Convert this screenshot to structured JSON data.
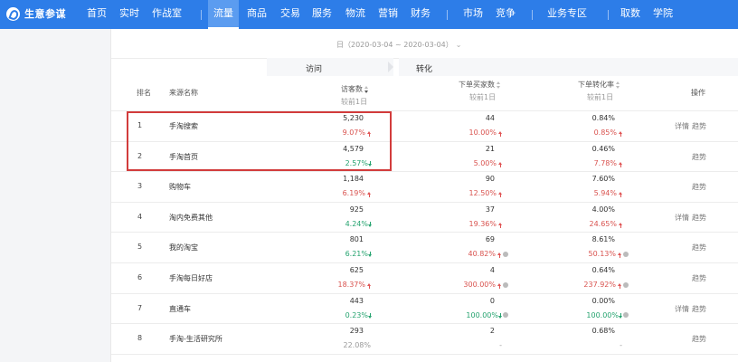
{
  "brand": {
    "name": "生意参谋"
  },
  "nav": {
    "items": [
      "首页",
      "实时",
      "作战室",
      "流量",
      "商品",
      "交易",
      "服务",
      "物流",
      "营销",
      "财务",
      "市场",
      "竞争",
      "业务专区",
      "取数",
      "学院"
    ],
    "active": "流量"
  },
  "filters": {
    "date_range": "日（2020-03-04 ~ 2020-03-04）"
  },
  "table": {
    "groups": {
      "visit": "访问",
      "conversion": "转化"
    },
    "headers": {
      "rank": "排名",
      "source": "来源名称",
      "visitors": "访客数",
      "buyers": "下单买家数",
      "conv_rate": "下单转化率",
      "compare": "较前1日",
      "actions": "操作"
    },
    "action_labels": {
      "detail": "详情",
      "trend": "趋势"
    },
    "rows": [
      {
        "rank": "1",
        "source": "手淘搜索",
        "visitors": "5,230",
        "visitors_chg": "9.07%",
        "visitors_dir": "up",
        "buyers": "44",
        "buyers_chg": "10.00%",
        "buyers_dir": "up",
        "rate": "0.84%",
        "rate_chg": "0.85%",
        "rate_dir": "up",
        "detail": true
      },
      {
        "rank": "2",
        "source": "手淘首页",
        "visitors": "4,579",
        "visitors_chg": "2.57%",
        "visitors_dir": "down",
        "buyers": "21",
        "buyers_chg": "5.00%",
        "buyers_dir": "up",
        "rate": "0.46%",
        "rate_chg": "7.78%",
        "rate_dir": "up",
        "detail": false
      },
      {
        "rank": "3",
        "source": "购物车",
        "visitors": "1,184",
        "visitors_chg": "6.19%",
        "visitors_dir": "up",
        "buyers": "90",
        "buyers_chg": "12.50%",
        "buyers_dir": "up",
        "rate": "7.60%",
        "rate_chg": "5.94%",
        "rate_dir": "up",
        "detail": false
      },
      {
        "rank": "4",
        "source": "淘内免费其他",
        "visitors": "925",
        "visitors_chg": "4.24%",
        "visitors_dir": "down",
        "buyers": "37",
        "buyers_chg": "19.36%",
        "buyers_dir": "up",
        "rate": "4.00%",
        "rate_chg": "24.65%",
        "rate_dir": "up",
        "detail": true
      },
      {
        "rank": "5",
        "source": "我的淘宝",
        "visitors": "801",
        "visitors_chg": "6.21%",
        "visitors_dir": "down",
        "buyers": "69",
        "buyers_chg": "40.82%",
        "buyers_dir": "up-info",
        "rate": "8.61%",
        "rate_chg": "50.13%",
        "rate_dir": "up-info",
        "detail": false
      },
      {
        "rank": "6",
        "source": "手淘每日好店",
        "visitors": "625",
        "visitors_chg": "18.37%",
        "visitors_dir": "up",
        "buyers": "4",
        "buyers_chg": "300.00%",
        "buyers_dir": "up-info",
        "rate": "0.64%",
        "rate_chg": "237.92%",
        "rate_dir": "up-info",
        "detail": false
      },
      {
        "rank": "7",
        "source": "直通车",
        "visitors": "443",
        "visitors_chg": "0.23%",
        "visitors_dir": "down",
        "buyers": "0",
        "buyers_chg": "100.00%",
        "buyers_dir": "down-info",
        "rate": "0.00%",
        "rate_chg": "100.00%",
        "rate_dir": "down-info",
        "detail": true
      },
      {
        "rank": "8",
        "source": "手淘-生活研究所",
        "visitors": "293",
        "visitors_chg": "22.08%",
        "visitors_dir": "none",
        "buyers": "2",
        "buyers_chg": "-",
        "buyers_dir": "none",
        "rate": "0.68%",
        "rate_chg": "-",
        "rate_dir": "none",
        "detail": false
      }
    ]
  }
}
